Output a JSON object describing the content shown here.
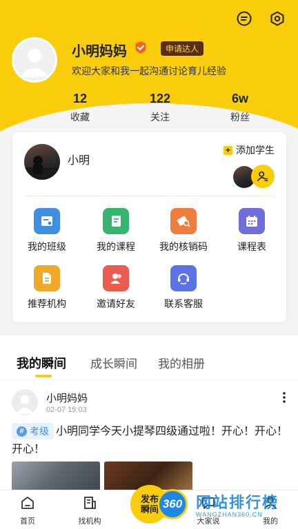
{
  "profile": {
    "nickname": "小明妈妈",
    "apply_label": "申请达人",
    "intro": "欢迎大家和我一起沟通讨论育儿经验",
    "stats": [
      {
        "value": "12",
        "label": "收藏"
      },
      {
        "value": "122",
        "label": "关注"
      },
      {
        "value": "6w",
        "label": "粉丝"
      }
    ]
  },
  "top_icons": [
    "menu-icon",
    "settings-icon"
  ],
  "student": {
    "name": "小明",
    "add_label": "添加学生"
  },
  "menu": [
    {
      "label": "我的班级",
      "icon": "class-icon",
      "color": "#3f8ee0"
    },
    {
      "label": "我的课程",
      "icon": "course-icon",
      "color": "#37b56f"
    },
    {
      "label": "我的核销码",
      "icon": "coupon-icon",
      "color": "#ef7d3e"
    },
    {
      "label": "课程表",
      "icon": "calendar-icon",
      "color": "#6e6fd8"
    },
    {
      "label": "推荐机构",
      "icon": "institution-icon",
      "color": "#f0a828"
    },
    {
      "label": "邀请好友",
      "icon": "invite-icon",
      "color": "#ea5c52"
    },
    {
      "label": "联系客服",
      "icon": "service-icon",
      "color": "#5a74e6"
    }
  ],
  "tabs": [
    {
      "label": "我的瞬间",
      "active": true
    },
    {
      "label": "成长瞬间",
      "active": false
    },
    {
      "label": "我的相册",
      "active": false
    }
  ],
  "post": {
    "author": "小明妈妈",
    "time": "02-07 15:03",
    "tag": "考级",
    "text": "小明同学今天小提琴四级通过啦！开心！开心！开心！"
  },
  "nav": [
    {
      "label": "首页",
      "icon": "home-icon"
    },
    {
      "label": "找机构",
      "icon": "building-icon"
    },
    {
      "label": "大家说",
      "icon": "chat-icon"
    },
    {
      "label": "我的",
      "icon": "profile-icon"
    }
  ],
  "publish_label_1": "发布",
  "publish_label_2": "瞬间",
  "watermark": {
    "badge": "360",
    "title": "网站排行榜",
    "sub": "WANGZHAN360.CN"
  },
  "colors": {
    "brand": "#f9cd0b",
    "brown": "#5a2e16",
    "tag_blue": "#4a8ee0"
  }
}
